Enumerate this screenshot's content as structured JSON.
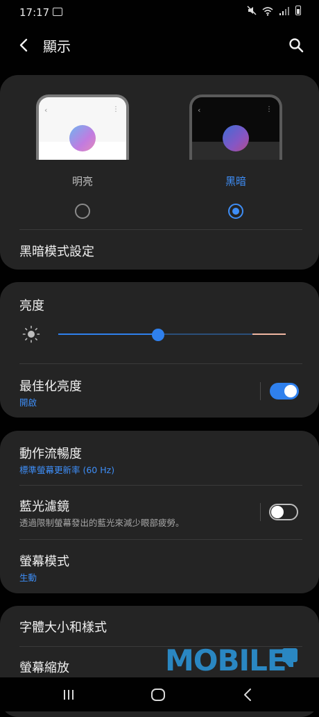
{
  "status_bar": {
    "time": "17:17"
  },
  "header": {
    "title": "顯示"
  },
  "theme": {
    "options": [
      {
        "label": "明亮",
        "selected": false
      },
      {
        "label": "黑暗",
        "selected": true
      }
    ],
    "dark_mode_settings": "黑暗模式設定"
  },
  "brightness": {
    "title": "亮度",
    "level_percent": 44,
    "adaptive": {
      "title": "最佳化亮度",
      "status": "開啟",
      "enabled": true
    }
  },
  "motion_smoothness": {
    "title": "動作流暢度",
    "value": "標準螢幕更新率 (60 Hz)"
  },
  "blue_light_filter": {
    "title": "藍光濾鏡",
    "description": "透過限制螢幕發出的藍光來減少眼部疲勞。",
    "enabled": false
  },
  "screen_mode": {
    "title": "螢幕模式",
    "value": "生動"
  },
  "font_size": {
    "title": "字體大小和樣式"
  },
  "screen_zoom": {
    "title": "螢幕縮放"
  },
  "watermark": {
    "text": "MOBILE"
  },
  "colors": {
    "accent": "#3e8ef7",
    "card": "#242424",
    "background": "#010101"
  }
}
